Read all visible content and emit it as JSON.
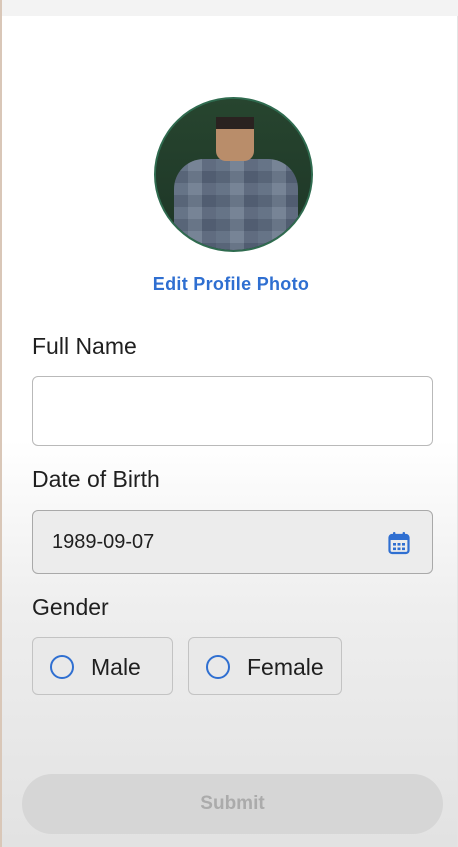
{
  "profile": {
    "edit_photo_label": "Edit Profile Photo"
  },
  "form": {
    "full_name": {
      "label": "Full Name",
      "value": "",
      "placeholder": ""
    },
    "dob": {
      "label": "Date of Birth",
      "value": "1989-09-07",
      "icon": "calendar-icon"
    },
    "gender": {
      "label": "Gender",
      "options": [
        {
          "label": "Male",
          "selected": false
        },
        {
          "label": "Female",
          "selected": false
        }
      ]
    },
    "submit_label": "Submit"
  },
  "colors": {
    "accent": "#2f6fd1",
    "disabled_button": "#d6d6d6",
    "disabled_text": "#ababab"
  }
}
